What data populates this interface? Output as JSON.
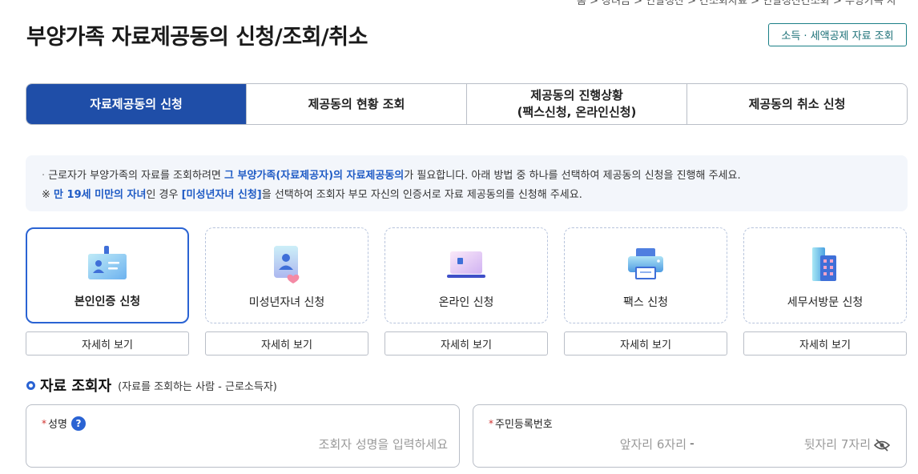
{
  "header": {
    "breadcrumb": "홈 > 장려금 > 연말정산 > 간소화자료 > 연말정산간소화 > 부양가족 자",
    "title": "부양가족 자료제공동의 신청/조회/취소",
    "link_button": "소득 · 세액공제 자료 조회"
  },
  "tabs": [
    {
      "label": "자료제공동의 신청",
      "active": true
    },
    {
      "label": "제공동의 현황 조회",
      "active": false
    },
    {
      "label_line1": "제공동의 진행상황",
      "label_line2": "(팩스신청, 온라인신청)",
      "active": false
    },
    {
      "label": "제공동의 취소 신청",
      "active": false
    }
  ],
  "notice": {
    "line1": {
      "bullet": "·",
      "part1": "근로자가 부양가족의 자료를 조회하려면 ",
      "highlight": "그 부양가족(자료제공자)의 자료제공동의",
      "part2": "가 필요합니다. 아래 방법 중 하나를 선택하여 제공동의 신청을 진행해 주세요."
    },
    "line2": {
      "mark": "※",
      "highlight1": "만 19세 미만의 자녀",
      "part1": "인 경우 ",
      "highlight2": "[미성년자녀 신청]",
      "part2": "을 선택하여 조회자 부모 자신의 인증서로 자료 제공동의를 신청해 주세요."
    }
  },
  "methods": [
    {
      "label": "본인인증 신청",
      "icon": "id-card-icon",
      "active": true,
      "detail": "자세히 보기"
    },
    {
      "label": "미성년자녀 신청",
      "icon": "child-heart-icon",
      "active": false,
      "detail": "자세히 보기"
    },
    {
      "label": "온라인 신청",
      "icon": "laptop-icon",
      "active": false,
      "detail": "자세히 보기"
    },
    {
      "label": "팩스 신청",
      "icon": "fax-printer-icon",
      "active": false,
      "detail": "자세히 보기"
    },
    {
      "label": "세무서방문 신청",
      "icon": "office-building-icon",
      "active": false,
      "detail": "자세히 보기"
    }
  ],
  "section": {
    "title": "자료 조회자",
    "subtitle": "(자료를 조회하는 사람 - 근로소득자)"
  },
  "form": {
    "name": {
      "required_mark": "*",
      "label": "성명",
      "help": "?",
      "placeholder": "조회자 성명을 입력하세요",
      "value": ""
    },
    "rrn": {
      "required_mark": "*",
      "label": "주민등록번호",
      "front_placeholder": "앞자리 6자리",
      "separator": "-",
      "back_placeholder": "뒷자리 7자리",
      "toggle_icon": "eye-slash-icon"
    }
  },
  "colors": {
    "primary": "#1f4ea8",
    "accent": "#2a63d3",
    "teal": "#1a7f86",
    "notice_bg": "#f3f6fb",
    "required": "#d0312d"
  }
}
